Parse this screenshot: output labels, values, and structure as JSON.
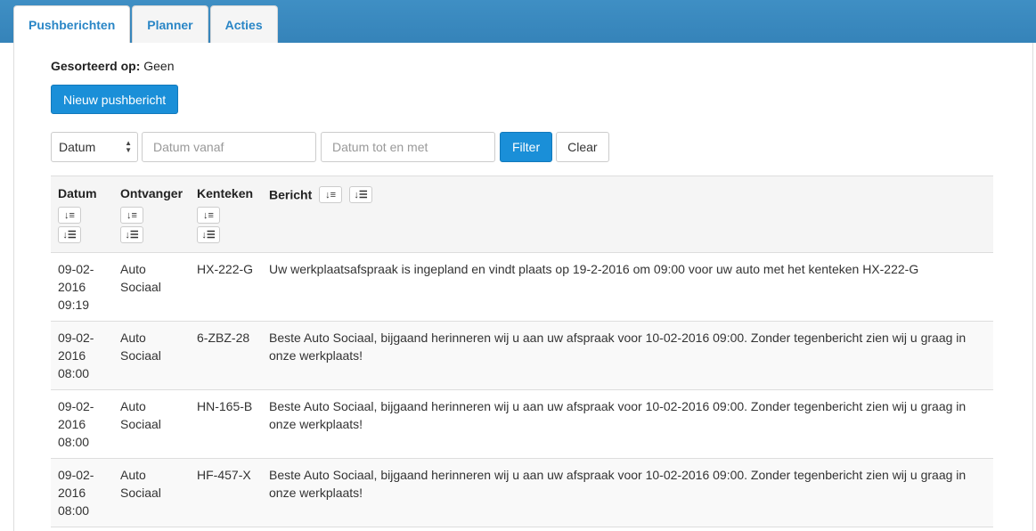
{
  "tabs": [
    {
      "label": "Pushberichten",
      "active": true
    },
    {
      "label": "Planner",
      "active": false
    },
    {
      "label": "Acties",
      "active": false
    }
  ],
  "sort": {
    "label": "Gesorteerd op:",
    "value": "Geen"
  },
  "new_button": "Nieuw pushbericht",
  "filter": {
    "select_value": "Datum",
    "from_placeholder": "Datum vanaf",
    "to_placeholder": "Datum tot en met",
    "filter_label": "Filter",
    "clear_label": "Clear"
  },
  "table": {
    "headers": {
      "date": "Datum",
      "recipient": "Ontvanger",
      "plate": "Kenteken",
      "message": "Bericht"
    },
    "rows": [
      {
        "date": "09-02-2016 09:19",
        "recipient": "Auto Sociaal",
        "plate": "HX-222-G",
        "message": "Uw werkplaatsafspraak is ingepland en vindt plaats op 19-2-2016 om 09:00 voor uw auto met het kenteken HX-222-G"
      },
      {
        "date": "09-02-2016 08:00",
        "recipient": "Auto Sociaal",
        "plate": "6-ZBZ-28",
        "message": "Beste Auto Sociaal, bijgaand herinneren wij u aan uw afspraak voor 10-02-2016 09:00. Zonder tegenbericht zien wij u graag in onze werkplaats!"
      },
      {
        "date": "09-02-2016 08:00",
        "recipient": "Auto Sociaal",
        "plate": "HN-165-B",
        "message": "Beste Auto Sociaal, bijgaand herinneren wij u aan uw afspraak voor 10-02-2016 09:00. Zonder tegenbericht zien wij u graag in onze werkplaats!"
      },
      {
        "date": "09-02-2016 08:00",
        "recipient": "Auto Sociaal",
        "plate": "HF-457-X",
        "message": "Beste Auto Sociaal, bijgaand herinneren wij u aan uw afspraak voor 10-02-2016 09:00. Zonder tegenbericht zien wij u graag in onze werkplaats!"
      }
    ]
  },
  "icons": {
    "sort_asc": "sort-amount-asc-icon",
    "sort_desc": "sort-amount-desc-icon"
  },
  "colors": {
    "topbar": "#3a8bc0",
    "primary": "#1a8fd8",
    "tab_text": "#2a86c6"
  }
}
